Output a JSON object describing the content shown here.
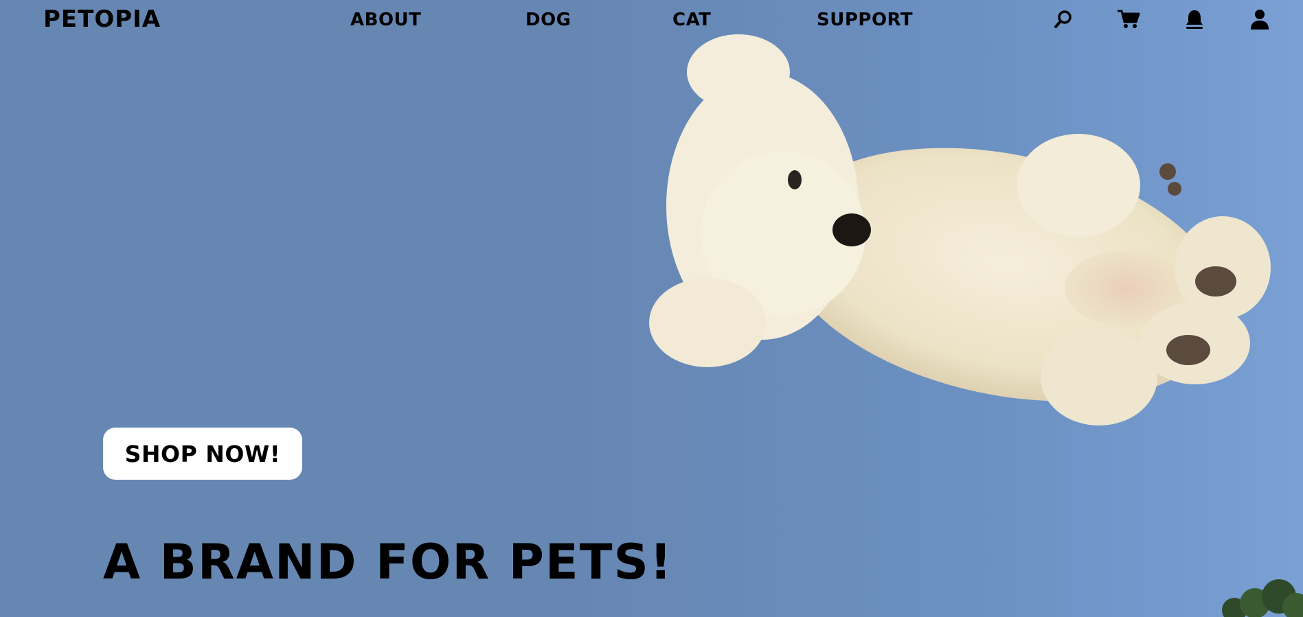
{
  "brand": {
    "logo_text": "PETOPIA"
  },
  "nav": {
    "links": [
      {
        "label": "ABOUT"
      },
      {
        "label": "DOG"
      },
      {
        "label": "CAT"
      },
      {
        "label": "SUPPORT"
      }
    ]
  },
  "header_icons": [
    {
      "icon": "search-icon"
    },
    {
      "icon": "cart-icon"
    },
    {
      "icon": "bell-icon"
    },
    {
      "icon": "user-icon"
    }
  ],
  "hero": {
    "cta_label": "SHOP NOW!",
    "headline": "A BRAND FOR PETS!",
    "image": "white-fluffy-dog-jumping-against-blue-sky"
  },
  "colors": {
    "sky_blue": "#6687b2",
    "button_bg": "#ffffff",
    "text": "#000000"
  }
}
